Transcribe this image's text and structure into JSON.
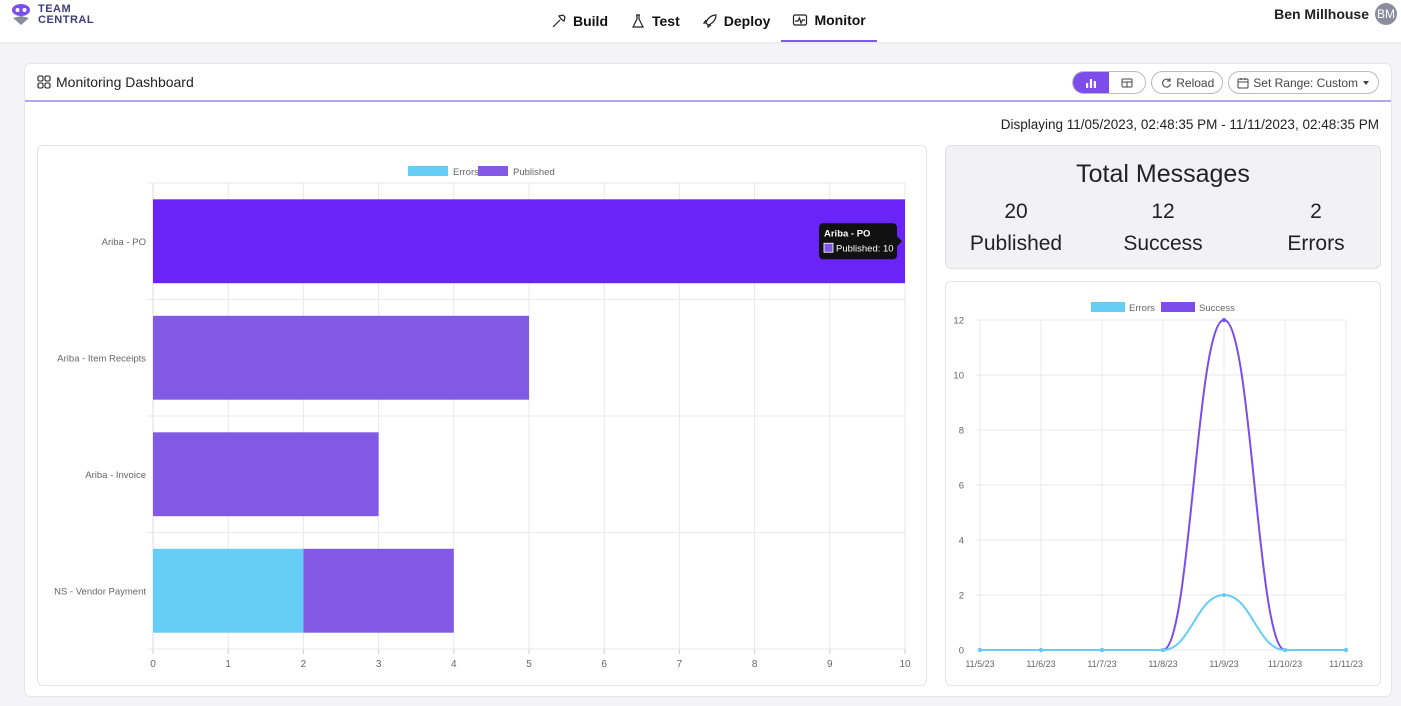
{
  "brand": {
    "line1": "TEAM",
    "line2": "CENTRAL"
  },
  "nav": [
    {
      "label": "Build",
      "icon": "hammer-icon"
    },
    {
      "label": "Test",
      "icon": "flask-icon"
    },
    {
      "label": "Deploy",
      "icon": "rocket-icon"
    },
    {
      "label": "Monitor",
      "icon": "monitor-icon",
      "active": true
    }
  ],
  "user": {
    "name": "Ben Millhouse",
    "initials": "BM"
  },
  "panel": {
    "title": "Monitoring Dashboard",
    "reload": "Reload",
    "range": "Set Range: Custom"
  },
  "range_text": "Displaying 11/05/2023, 02:48:35 PM - 11/11/2023, 02:48:35 PM",
  "totals": {
    "title": "Total Messages",
    "published": {
      "value": "20",
      "label": "Published"
    },
    "success": {
      "value": "12",
      "label": "Success"
    },
    "errors": {
      "value": "2",
      "label": "Errors"
    }
  },
  "colors": {
    "accent": "#7c4dea",
    "errors": "#66cdf7",
    "published": "#8159e4",
    "highlight": "#6a24f7",
    "success": "#7c4dea"
  },
  "chart_data": [
    {
      "type": "bar",
      "orientation": "horizontal",
      "stacked": true,
      "categories": [
        "Ariba - PO",
        "Ariba - Item Receipts",
        "Ariba - Invoice",
        "NS - Vendor Payment"
      ],
      "series": [
        {
          "name": "Errors",
          "values": [
            0,
            0,
            0,
            2
          ]
        },
        {
          "name": "Published",
          "values": [
            10,
            5,
            3,
            2
          ]
        }
      ],
      "xlim": [
        0,
        10
      ],
      "xticks": [
        0,
        1,
        2,
        3,
        4,
        5,
        6,
        7,
        8,
        9,
        10
      ],
      "legend": "top",
      "grid": true,
      "tooltip": {
        "title": "Ariba - PO",
        "text": "Published: 10"
      }
    },
    {
      "type": "line",
      "x": [
        "11/5/23",
        "11/6/23",
        "11/7/23",
        "11/8/23",
        "11/9/23",
        "11/10/23",
        "11/11/23"
      ],
      "series": [
        {
          "name": "Errors",
          "values": [
            0,
            0,
            0,
            0,
            2,
            0,
            0
          ]
        },
        {
          "name": "Success",
          "values": [
            0,
            0,
            0,
            0,
            12,
            0,
            0
          ]
        }
      ],
      "ylim": [
        0,
        12
      ],
      "yticks": [
        0,
        2,
        4,
        6,
        8,
        10,
        12
      ],
      "legend": "top",
      "grid": true
    }
  ]
}
